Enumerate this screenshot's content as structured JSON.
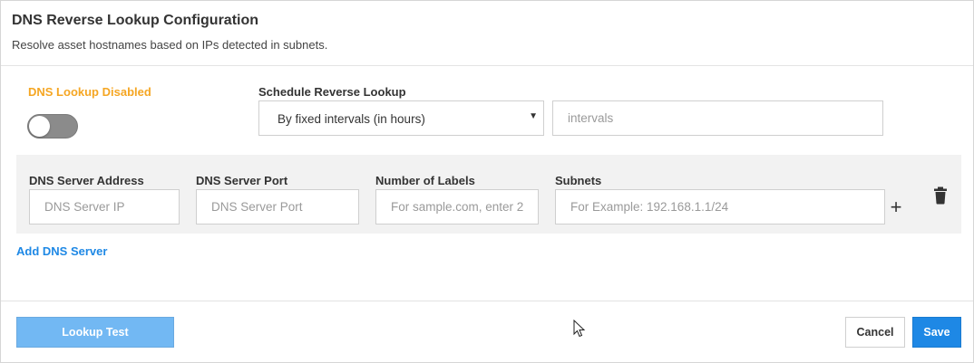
{
  "header": {
    "title": "DNS Reverse Lookup Configuration",
    "subtitle": "Resolve asset hostnames based on IPs detected in subnets."
  },
  "dns_lookup": {
    "status_label": "DNS Lookup Disabled",
    "status_color": "#f5a623",
    "enabled": false
  },
  "schedule": {
    "label": "Schedule Reverse Lookup",
    "selected_option": "By fixed intervals (in hours)",
    "intervals_placeholder": "intervals",
    "intervals_value": ""
  },
  "server_row": {
    "address_label": "DNS Server Address",
    "address_placeholder": "DNS Server IP",
    "port_label": "DNS Server Port",
    "port_placeholder": "DNS Server Port",
    "labels_label": "Number of Labels",
    "labels_placeholder": "For sample.com, enter 2",
    "subnets_label": "Subnets",
    "subnets_placeholder": "For Example: 192.168.1.1/24",
    "add_subnet_icon": "plus-icon",
    "delete_icon": "trash-icon"
  },
  "add_server_link": "Add DNS Server",
  "footer": {
    "lookup_test_label": "Lookup Test",
    "cancel_label": "Cancel",
    "save_label": "Save"
  },
  "colors": {
    "accent": "#1e88e5",
    "accent_disabled": "#72b8f3",
    "warning": "#f5a623",
    "panel_bg": "#f2f2f2"
  }
}
